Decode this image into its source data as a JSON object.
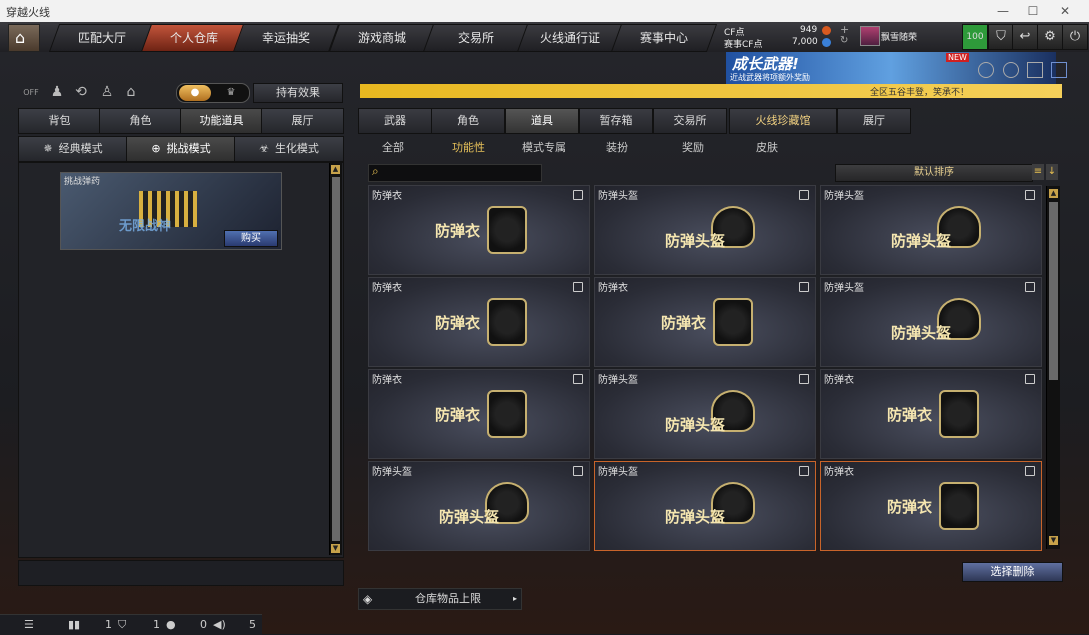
{
  "window": {
    "title": "穿越火线"
  },
  "nav": {
    "tabs": [
      "匹配大厅",
      "个人仓库",
      "幸运抽奖",
      "游戏商城",
      "交易所",
      "火线通行证",
      "赛事中心"
    ],
    "active": "个人仓库"
  },
  "currency": {
    "cf_label": "CF点",
    "cf_value": "949",
    "event_label": "赛事CF点",
    "event_value": "7,000"
  },
  "user": {
    "name": "飘雪随荣",
    "level": "100"
  },
  "banner": {
    "text": "成长武器!",
    "sub": "近战武器将项额外奖励",
    "badge": "NEW"
  },
  "ticker": {
    "text": "全区五谷丰登，笑承不！"
  },
  "left": {
    "effect_button": "持有效果",
    "off_label": "OFF",
    "tabs": [
      "背包",
      "角色",
      "功能道具",
      "展厅"
    ],
    "active_tab": "功能道具",
    "modes": [
      "经典模式",
      "挑战模式",
      "生化模式"
    ],
    "active_mode": "挑战模式",
    "challenge": {
      "title": "挑战弹药",
      "watermark": "无限战神",
      "buy": "购买"
    }
  },
  "right": {
    "tabs": [
      "武器",
      "角色",
      "道具",
      "暂存箱",
      "交易所",
      "火线珍藏馆",
      "展厅"
    ],
    "active_tab": "道具",
    "subtabs": [
      "全部",
      "功能性",
      "模式专属",
      "装扮",
      "奖励",
      "皮肤"
    ],
    "active_sub": "功能性",
    "search_placeholder": "",
    "sort_label": "默认排序",
    "items": [
      {
        "name": "防弹衣",
        "label": "防弹衣",
        "type": "vest"
      },
      {
        "name": "防弹头盔",
        "label": "防弹头盔",
        "type": "helmet"
      },
      {
        "name": "防弹头盔",
        "label": "防弹头盔",
        "type": "helmet"
      },
      {
        "name": "防弹衣",
        "label": "防弹衣",
        "type": "vest"
      },
      {
        "name": "防弹衣",
        "label": "防弹衣",
        "type": "vest"
      },
      {
        "name": "防弹头盔",
        "label": "防弹头盔",
        "type": "helmet"
      },
      {
        "name": "防弹衣",
        "label": "防弹衣",
        "type": "vest"
      },
      {
        "name": "防弹头盔",
        "label": "防弹头盔",
        "type": "helmet"
      },
      {
        "name": "防弹衣",
        "label": "防弹衣",
        "type": "vest"
      },
      {
        "name": "防弹头盔",
        "label": "防弹头盔",
        "type": "helmet"
      },
      {
        "name": "防弹头盔",
        "label": "防弹头盔",
        "type": "helmet",
        "selected": true
      },
      {
        "name": "防弹衣",
        "label": "防弹衣",
        "type": "vest",
        "selected": true
      }
    ],
    "delete_button": "选择删除",
    "capacity_button": "仓库物品上限"
  },
  "status": {
    "v1": "1",
    "v2": "1",
    "v3": "0",
    "v4": "5"
  }
}
